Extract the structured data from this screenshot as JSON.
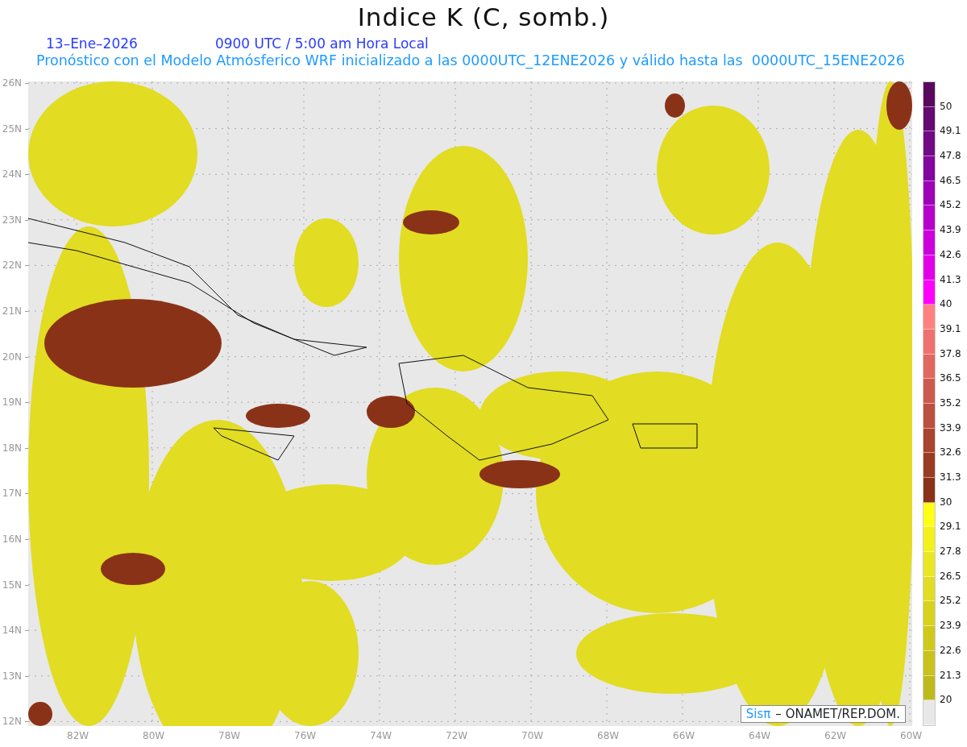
{
  "title": "Indice K (C, somb.)",
  "date": "13–Ene–2026",
  "time": "0900 UTC / 5:00 am Hora Local",
  "subtitle": "Pronóstico con el Modelo Atmósferico WRF inicializado a las 0000UTC_12ENE2026 y válido hasta las  0000UTC_15ENE2026",
  "map": {
    "lat_labels": [
      "26N",
      "25N",
      "24N",
      "23N",
      "22N",
      "21N",
      "20N",
      "19N",
      "18N",
      "17N",
      "16N",
      "15N",
      "14N",
      "13N",
      "12N"
    ],
    "lon_labels": [
      "82W",
      "80W",
      "78W",
      "76W",
      "74W",
      "72W",
      "70W",
      "68W",
      "66W",
      "64W",
      "62W",
      "60W"
    ],
    "credit": {
      "logo": "Sisπ",
      "text": "– ONAMET/REP.DOM."
    }
  },
  "colorbar": [
    {
      "color": "#5a0a5e"
    },
    {
      "color": "#650a72",
      "label": "50"
    },
    {
      "color": "#730a85",
      "label": "49.1"
    },
    {
      "color": "#8306a0",
      "label": "47.8"
    },
    {
      "color": "#9d04b8",
      "label": "46.5"
    },
    {
      "color": "#b602cc",
      "label": "45.2"
    },
    {
      "color": "#cc00dc",
      "label": "43.9"
    },
    {
      "color": "#e200e8",
      "label": "42.6"
    },
    {
      "color": "#ff00ff",
      "label": "41.3"
    },
    {
      "color": "#ff8080",
      "label": "40"
    },
    {
      "color": "#f07070",
      "label": "39.1"
    },
    {
      "color": "#e0685e",
      "label": "37.8"
    },
    {
      "color": "#cc5a4e",
      "label": "36.5"
    },
    {
      "color": "#bb4f40",
      "label": "35.2"
    },
    {
      "color": "#a9442e",
      "label": "33.9"
    },
    {
      "color": "#9a3c22",
      "label": "32.6"
    },
    {
      "color": "#8a3218",
      "label": "31.3"
    },
    {
      "color": "#ffff18",
      "label": "30"
    },
    {
      "color": "#f4f01c",
      "label": "29.1"
    },
    {
      "color": "#ebe622",
      "label": "27.8"
    },
    {
      "color": "#e2dc22",
      "label": "26.5"
    },
    {
      "color": "#d8d21e",
      "label": "25.2"
    },
    {
      "color": "#cfc91c",
      "label": "23.9"
    },
    {
      "color": "#c7c21c",
      "label": "22.6"
    },
    {
      "color": "#bfba1c",
      "label": "21.3"
    },
    {
      "color": "#e8e8e8",
      "label": "20"
    }
  ]
}
